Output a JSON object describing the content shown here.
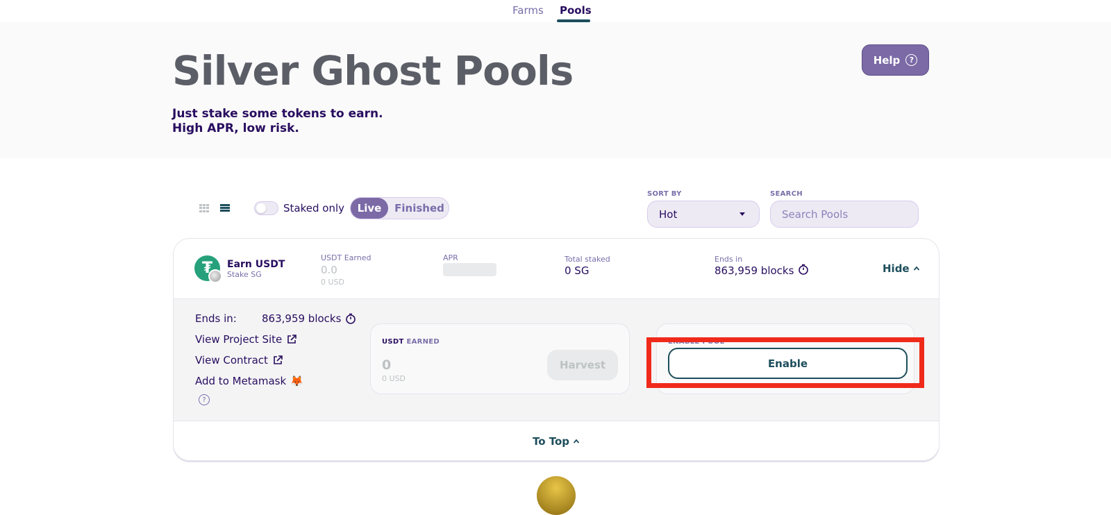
{
  "nav": {
    "tabs": [
      {
        "label": "Farms"
      },
      {
        "label": "Pools"
      }
    ]
  },
  "hero": {
    "title": "Silver Ghost Pools",
    "subtitle_line1": "Just stake some tokens to earn.",
    "subtitle_line2": "High APR, low risk.",
    "help_label": "Help"
  },
  "controls": {
    "view_icons": [
      "grid-view-icon",
      "list-view-icon"
    ],
    "staked_only_label": "Staked only",
    "staked_only_on": false,
    "filter": {
      "live_label": "Live",
      "finished_label": "Finished",
      "selected": "Live"
    },
    "sort": {
      "label": "SORT BY",
      "value": "Hot"
    },
    "search": {
      "label": "SEARCH",
      "placeholder": "Search Pools"
    }
  },
  "pool": {
    "name": "Earn USDT",
    "sub": "Stake SG",
    "earned": {
      "label": "USDT Earned",
      "value": "0.0",
      "usd": "0 USD"
    },
    "apr_label": "APR",
    "total_staked": {
      "label": "Total staked",
      "value": "0 SG"
    },
    "ends": {
      "label": "Ends in",
      "value": "863,959 blocks"
    },
    "hide_label": "Hide",
    "details": {
      "ends_label": "Ends in:",
      "ends_value": "863,959 blocks",
      "project_site": "View Project Site",
      "contract": "View Contract",
      "metamask": "Add to Metamask",
      "metamask_icon": "🦊"
    },
    "earned_panel": {
      "label_a": "USDT",
      "label_b": " EARNED",
      "value": "0",
      "usd": "0 USD",
      "harvest_label": "Harvest"
    },
    "enable_panel": {
      "label": "ENABLE POOL",
      "button_label": "Enable"
    },
    "to_top_label": "To Top"
  },
  "colors": {
    "primary": "#7b6aa6",
    "secondary": "#1d4e5c",
    "highlight": "#f02a1a",
    "text": "#280d5f"
  }
}
